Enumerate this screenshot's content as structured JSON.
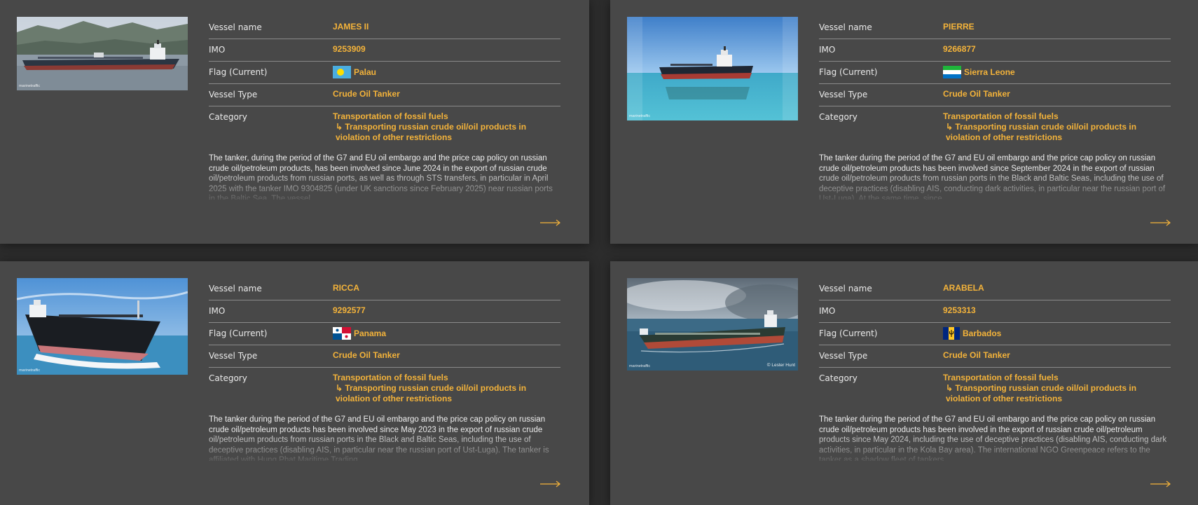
{
  "labels": {
    "vessel_name": "Vessel name",
    "imo": "IMO",
    "flag": "Flag (Current)",
    "vessel_type": "Vessel Type",
    "category": "Category"
  },
  "colors": {
    "accent": "#f4b33a",
    "card_bg": "#484848",
    "page_bg": "#2c2c2c",
    "text": "#f0f0f0"
  },
  "icons": {
    "next": "arrow-right-icon"
  },
  "cards": [
    {
      "vessel_name": "JAMES II",
      "imo": "9253909",
      "flag_country": "Palau",
      "flag_icon": "palau-flag-icon",
      "vessel_type": "Crude Oil Tanker",
      "category_main": "Transportation of fossil fuels",
      "category_sub": "↳ Transporting russian crude oil/oil products in violation of other restrictions",
      "watermark": "marinetraffic",
      "description": "The tanker, during the period of the G7 and EU oil embargo and the price cap policy on russian crude oil/petroleum products, has been involved since June 2024 in the export of russian crude oil/petroleum products from russian ports, as well as through STS transfers, in particular in April 2025 with the tanker IMO 9304825 (under UK sanctions since February 2025) near russian ports in the Baltic Sea. The vessel"
    },
    {
      "vessel_name": "PIERRE",
      "imo": "9266877",
      "flag_country": "Sierra Leone",
      "flag_icon": "sierra-leone-flag-icon",
      "vessel_type": "Crude Oil Tanker",
      "category_main": "Transportation of fossil fuels",
      "category_sub": "↳ Transporting russian crude oil/oil products in violation of other restrictions",
      "watermark": "marinetraffic",
      "description": "The tanker during the period of the G7 and EU oil embargo and the price cap policy on russian crude oil/petroleum products has been involved since September 2024 in the export of russian crude oil/petroleum products from russian ports in the Black and Baltic Seas, including the use of deceptive practices (disabling AIS, conducting dark activities, in particular near the russian port of Ust-Luga). At the same time, since"
    },
    {
      "vessel_name": "RICCA",
      "imo": "9292577",
      "flag_country": "Panama",
      "flag_icon": "panama-flag-icon",
      "vessel_type": "Crude Oil Tanker",
      "category_main": "Transportation of fossil fuels",
      "category_sub": "↳ Transporting russian crude oil/oil products in violation of other restrictions",
      "watermark": "marinetraffic",
      "description": "The tanker during the period of the G7 and EU oil embargo and the price cap policy on russian crude oil/petroleum products has been involved since May 2023 in the export of russian crude oil/petroleum products from russian ports in the Black and Baltic Seas, including the use of deceptive practices (disabling AIS, in particular near the russian port of Ust-Luga). The tanker is affiliated with Hung Phat Maritime Trading"
    },
    {
      "vessel_name": "ARABELA",
      "imo": "9253313",
      "flag_country": "Barbados",
      "flag_icon": "barbados-flag-icon",
      "vessel_type": "Crude Oil Tanker",
      "category_main": "Transportation of fossil fuels",
      "category_sub": "↳ Transporting russian crude oil/oil products in violation of other restrictions",
      "watermark": "marinetraffic",
      "credit": "© Lester Hunt",
      "description": "The tanker during the period of the G7 and EU oil embargo and the price cap policy on russian crude oil/petroleum products has been involved in the export of russian crude oil/petroleum products since May 2024, including the use of deceptive practices (disabling AIS, conducting dark activities, in particular in the Kola Bay area). The international NGO Greenpeace refers to the tanker as a shadow fleet of tankers"
    }
  ]
}
